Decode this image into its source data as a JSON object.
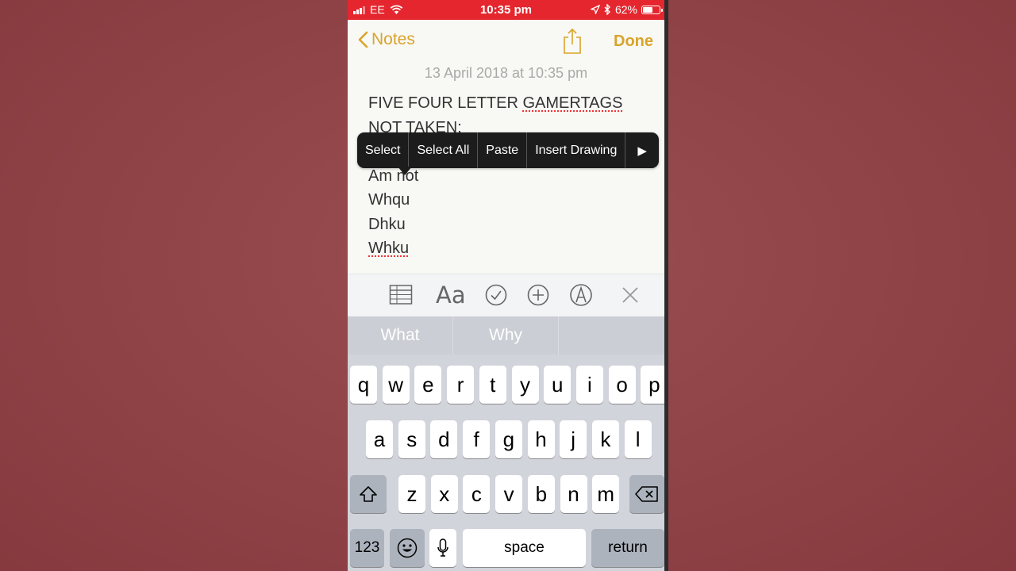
{
  "status_bar": {
    "carrier": "EE",
    "time": "10:35 pm",
    "battery": "62%",
    "battery_level": 0.62,
    "icons": [
      "signal-bars-icon",
      "wifi-icon",
      "location-arrow-icon",
      "bluetooth-icon",
      "battery-icon"
    ]
  },
  "nav": {
    "back_label": "Notes",
    "done_label": "Done"
  },
  "note": {
    "date": "13 April 2018 at 10:35 pm",
    "line1_prefix": "FIVE FOUR LETTER ",
    "line1_underlined": "GAMERTAGS",
    "line2": "NOT TAKEN:",
    "line3": "Am not",
    "line4": "Whqu",
    "line5": "Dhku",
    "line6": "Whku"
  },
  "edit_menu": {
    "select": "Select",
    "select_all": "Select All",
    "paste": "Paste",
    "insert_drawing": "Insert Drawing",
    "more": "▶"
  },
  "toolbar": {
    "format_label": "Aa",
    "icons": [
      "table-icon",
      "text-format-icon",
      "checklist-icon",
      "add-icon",
      "markup-icon",
      "close-icon"
    ]
  },
  "predictive": {
    "s1": "What",
    "s2": "Why",
    "s3": ""
  },
  "keyboard": {
    "row1": [
      "q",
      "w",
      "e",
      "r",
      "t",
      "y",
      "u",
      "i",
      "o",
      "p"
    ],
    "row2": [
      "a",
      "s",
      "d",
      "f",
      "g",
      "h",
      "j",
      "k",
      "l"
    ],
    "row3": [
      "z",
      "x",
      "c",
      "v",
      "b",
      "n",
      "m"
    ],
    "numbers": "123",
    "space": "space",
    "return": "return"
  },
  "colors": {
    "status_bar": "#e5262e",
    "accent": "#d9a42a",
    "background": "#8f4347"
  }
}
